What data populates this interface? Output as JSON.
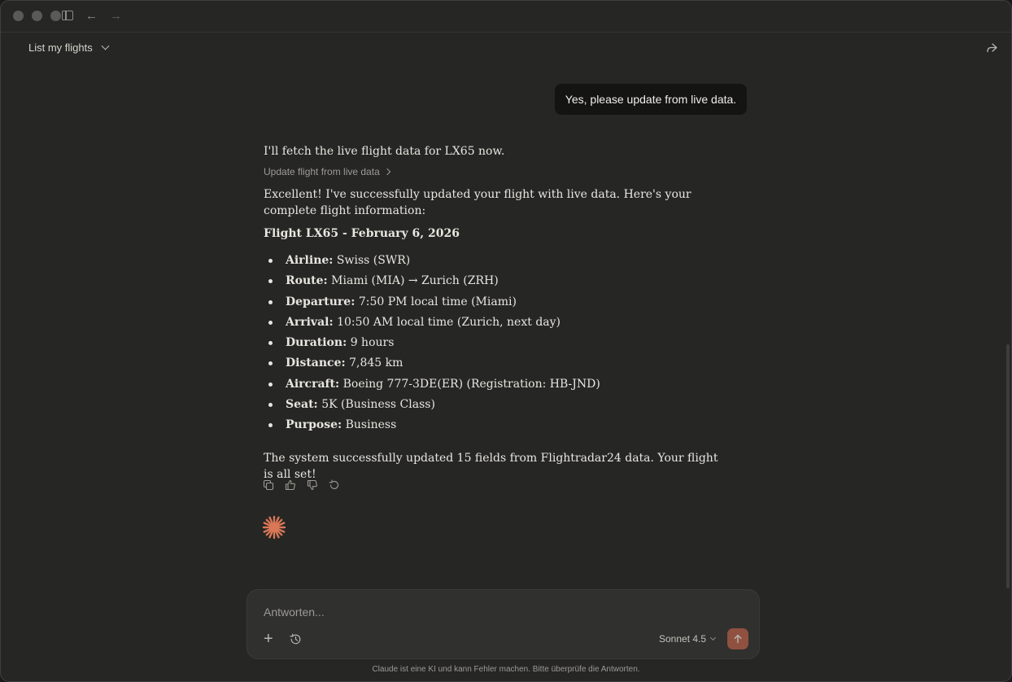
{
  "app": {
    "chat_title": "List my flights"
  },
  "conversation": {
    "user_message": "Yes, please update from live data.",
    "assistant_intro": "I'll fetch the live flight data for LX65 now.",
    "tool_call_label": "Update flight from live data",
    "assistant_success": "Excellent! I've successfully updated your flight with live data. Here's your complete flight information:",
    "flight_heading": "Flight LX65 - February 6, 2026",
    "details": [
      {
        "label": "Airline:",
        "value": "Swiss (SWR)"
      },
      {
        "label": "Route:",
        "value": "Miami (MIA) → Zurich (ZRH)"
      },
      {
        "label": "Departure:",
        "value": "7:50 PM local time (Miami)"
      },
      {
        "label": "Arrival:",
        "value": "10:50 AM local time (Zurich, next day)"
      },
      {
        "label": "Duration:",
        "value": "9 hours"
      },
      {
        "label": "Distance:",
        "value": "7,845 km"
      },
      {
        "label": "Aircraft:",
        "value": "Boeing 777-3DE(ER) (Registration: HB-JND)"
      },
      {
        "label": "Seat:",
        "value": "5K (Business Class)"
      },
      {
        "label": "Purpose:",
        "value": "Business"
      }
    ],
    "closing": "The system successfully updated 15 fields from Flightradar24 data. Your flight is all set!"
  },
  "composer": {
    "placeholder": "Antworten...",
    "model_label": "Sonnet 4.5"
  },
  "footer": {
    "disclaimer": "Claude ist eine KI und kann Fehler machen. Bitte überprüfe die Antworten."
  },
  "colors": {
    "background": "#262624",
    "accent": "#d97757",
    "send_button": "#c4644a"
  },
  "icons": [
    "sidebar-toggle-icon",
    "back-arrow-icon",
    "forward-arrow-icon",
    "chevron-down-icon",
    "share-icon",
    "copy-icon",
    "thumbs-up-icon",
    "thumbs-down-icon",
    "retry-icon",
    "claude-spark-icon",
    "plus-icon",
    "history-icon",
    "arrow-up-icon"
  ]
}
